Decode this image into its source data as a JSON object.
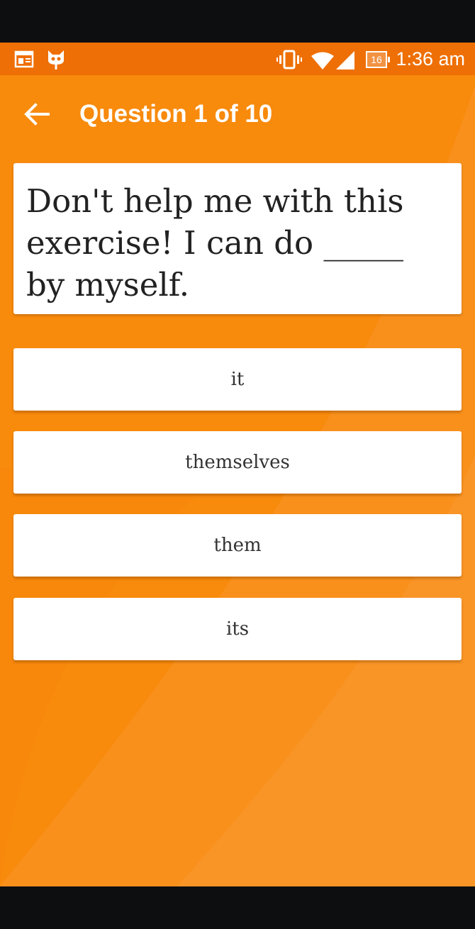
{
  "status_bar": {
    "time": "1:36 am",
    "battery_level": "16",
    "icons": [
      "calendar-icon",
      "cyanogen-mascot-icon",
      "vibrate-icon",
      "wifi-icon",
      "signal-icon",
      "battery-icon"
    ]
  },
  "toolbar": {
    "back_icon": "arrow-left-icon",
    "title": "Question 1 of 10"
  },
  "question": {
    "text": "Don't help me with this exercise! I can do _____ by myself."
  },
  "answers": [
    {
      "label": "it"
    },
    {
      "label": "themselves"
    },
    {
      "label": "them"
    },
    {
      "label": "its"
    }
  ],
  "colors": {
    "status_bar": "#ee6f05",
    "background": "#f88a0c",
    "card": "#ffffff",
    "question_text": "#222222",
    "answer_text": "#333333"
  }
}
